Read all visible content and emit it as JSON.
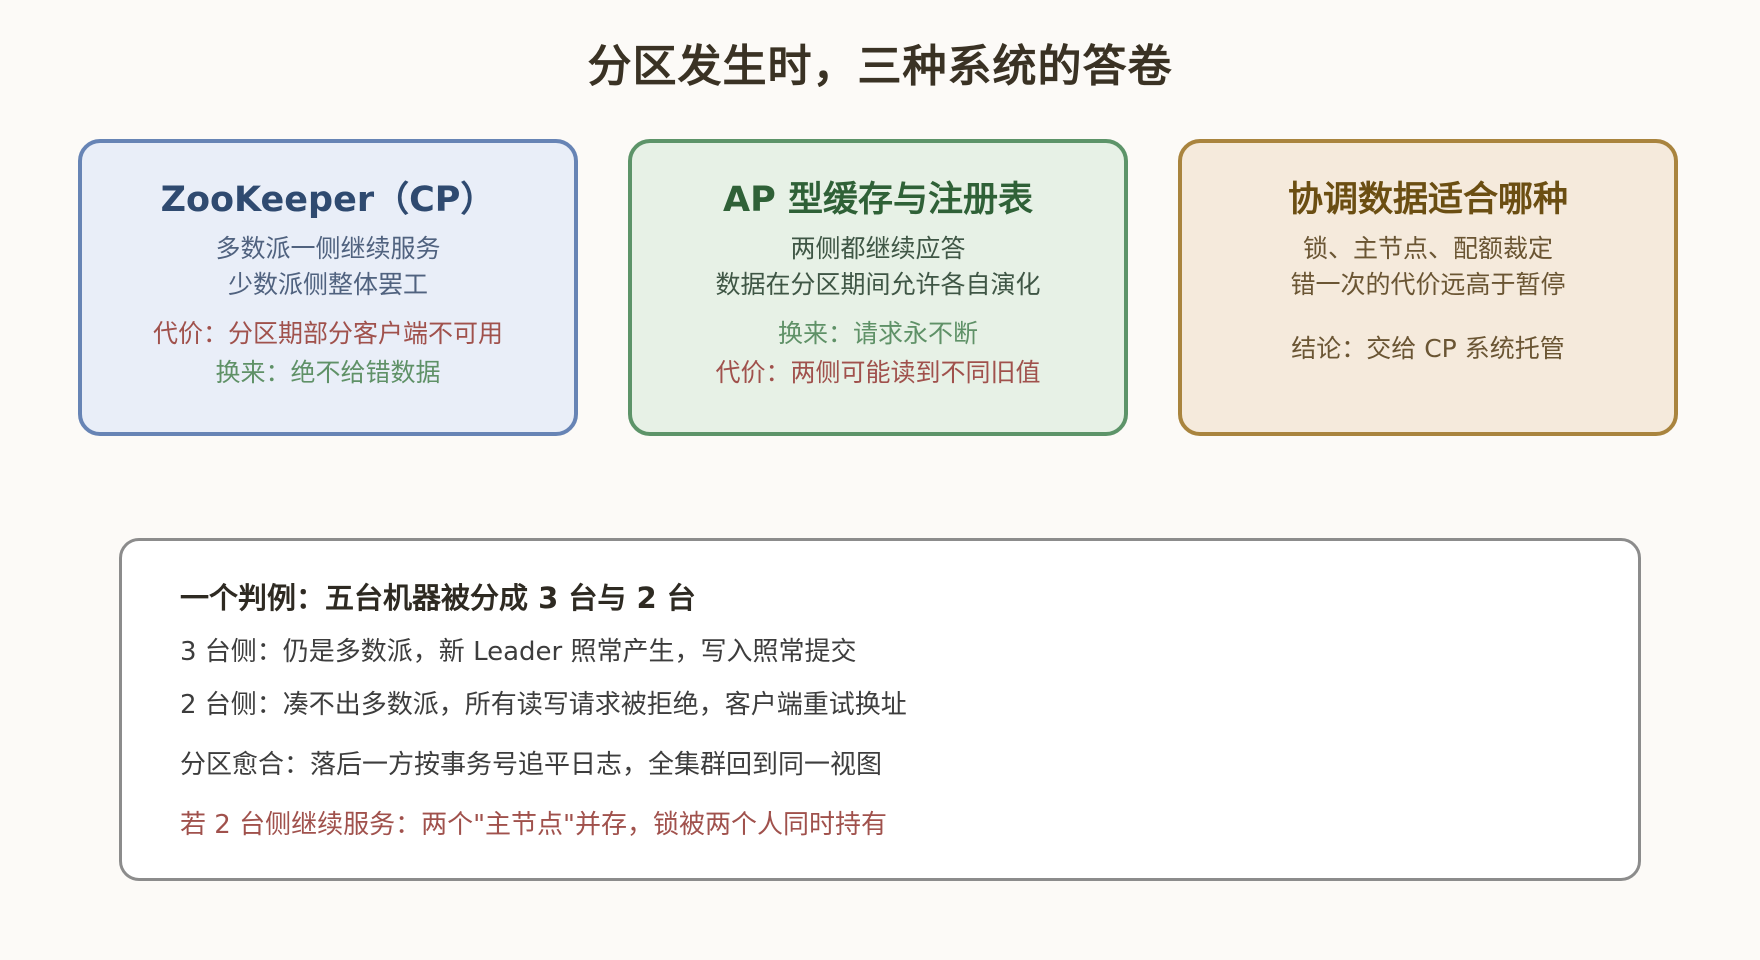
{
  "title": "分区发生时，三种系统的答卷",
  "cards": [
    {
      "title": "ZooKeeper（CP）",
      "desc1": "多数派一侧继续服务",
      "desc2": "少数派侧整体罢工",
      "cost": "代价：分区期部分客户端不可用",
      "gain": "换来：绝不给错数据"
    },
    {
      "title": "AP 型缓存与注册表",
      "desc1": "两侧都继续应答",
      "desc2": "数据在分区期间允许各自演化",
      "gain": "换来：请求永不断",
      "cost": "代价：两侧可能读到不同旧值"
    },
    {
      "title": "协调数据适合哪种",
      "desc1": "锁、主节点、配额裁定",
      "desc2": "错一次的代价远高于暂停",
      "conclusion": "结论：交给 CP 系统托管"
    }
  ],
  "panel": {
    "title": "一个判例：五台机器被分成 3 台与 2 台",
    "line1": "3 台侧：仍是多数派，新 Leader 照常产生，写入照常提交",
    "line2": "2 台侧：凑不出多数派，所有读写请求被拒绝，客户端重试换址",
    "line3": "分区愈合：落后一方按事务号追平日志，全集群回到同一视图",
    "warning": "若 2 台侧继续服务：两个\"主节点\"并存，锁被两个人同时持有"
  }
}
